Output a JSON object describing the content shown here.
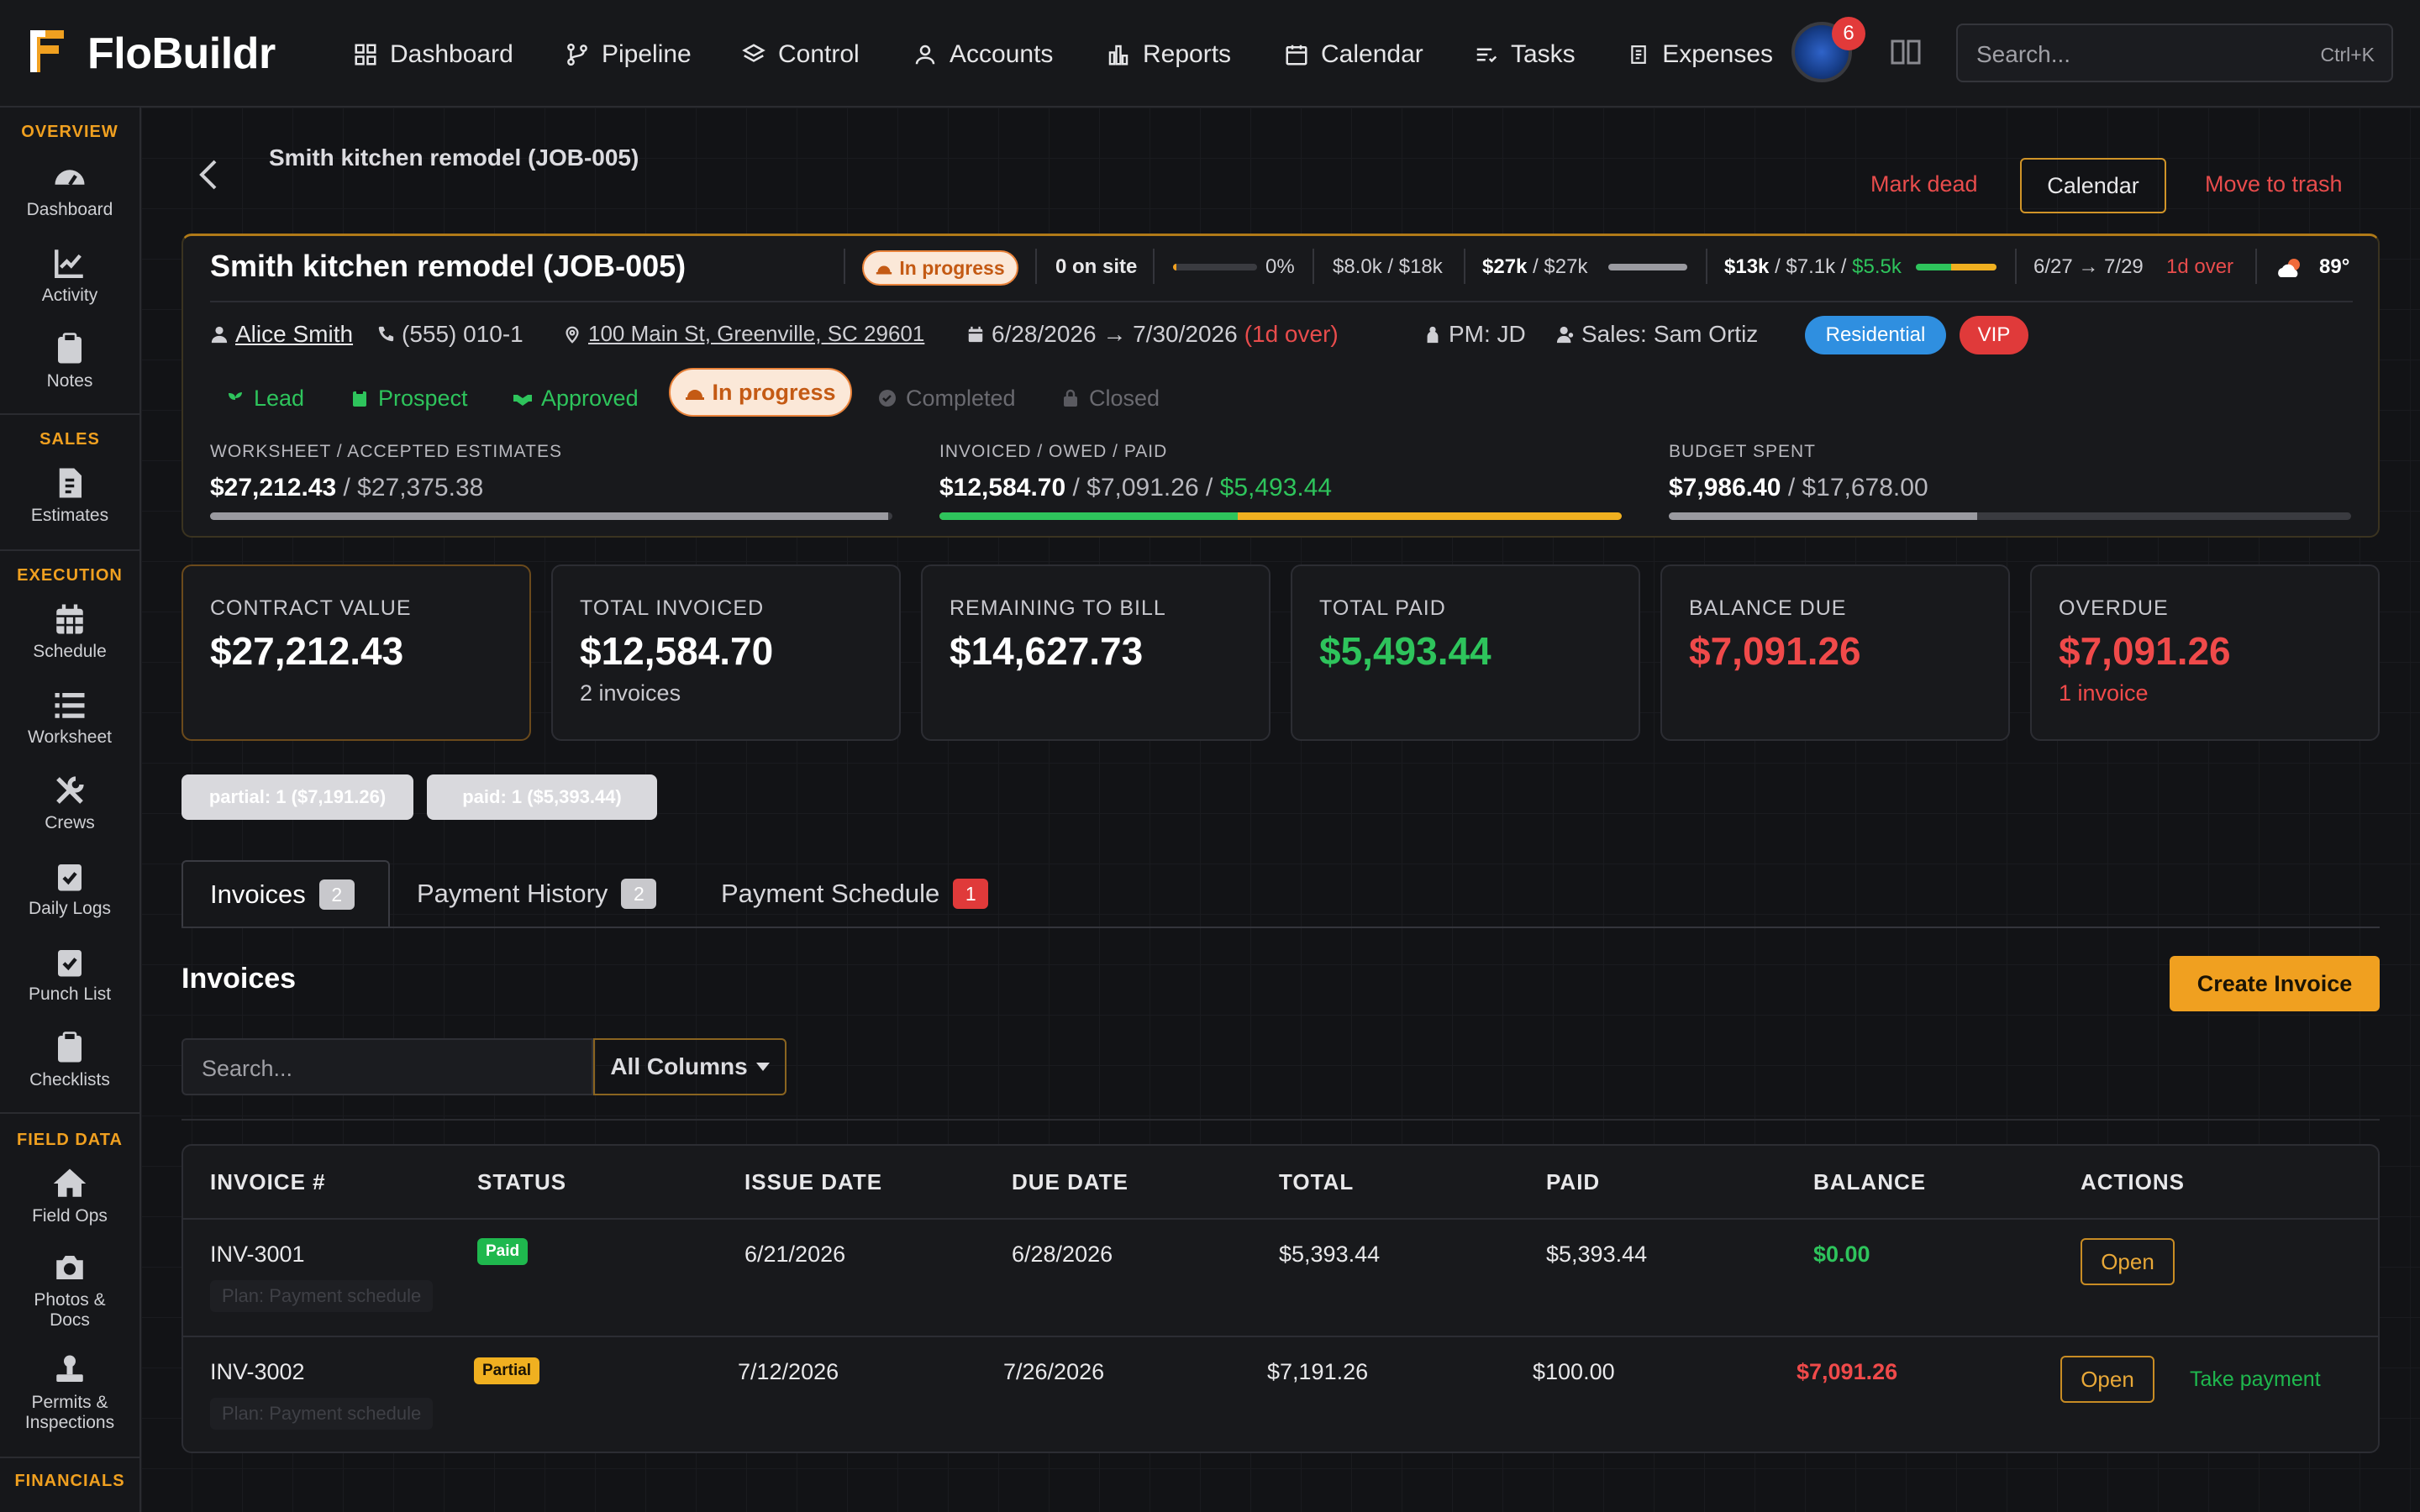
{
  "brand": {
    "name": "FloBuildr"
  },
  "nav": [
    {
      "label": "Dashboard",
      "icon": "dashboard-icon"
    },
    {
      "label": "Pipeline",
      "icon": "pipeline-icon"
    },
    {
      "label": "Control",
      "icon": "layers-icon"
    },
    {
      "label": "Accounts",
      "icon": "accounts-icon"
    },
    {
      "label": "Reports",
      "icon": "reports-icon"
    },
    {
      "label": "Calendar",
      "icon": "calendar-icon"
    },
    {
      "label": "Tasks",
      "icon": "tasks-icon"
    },
    {
      "label": "Expenses",
      "icon": "expenses-icon"
    }
  ],
  "notifications": {
    "count": "6"
  },
  "search": {
    "placeholder": "Search...",
    "shortcut": "Ctrl+K"
  },
  "sidebar": {
    "sections": [
      {
        "title": "OVERVIEW",
        "items": [
          {
            "label": "Dashboard",
            "icon": "gauge-icon"
          },
          {
            "label": "Activity",
            "icon": "activity-icon"
          },
          {
            "label": "Notes",
            "icon": "clipboard-icon"
          }
        ]
      },
      {
        "title": "SALES",
        "items": [
          {
            "label": "Estimates",
            "icon": "estimate-icon"
          }
        ]
      },
      {
        "title": "EXECUTION",
        "items": [
          {
            "label": "Schedule",
            "icon": "calendar-grid-icon"
          },
          {
            "label": "Worksheet",
            "icon": "list-icon"
          },
          {
            "label": "Crews",
            "icon": "tools-icon"
          },
          {
            "label": "Daily Logs",
            "icon": "clipboard-check-icon"
          },
          {
            "label": "Punch List",
            "icon": "clipboard-check-icon"
          },
          {
            "label": "Checklists",
            "icon": "clipboard-icon"
          }
        ]
      },
      {
        "title": "FIELD DATA",
        "items": [
          {
            "label": "Field Ops",
            "icon": "home-icon"
          },
          {
            "label": "Photos & Docs",
            "icon": "camera-icon"
          },
          {
            "label": "Permits & Inspections",
            "icon": "stamp-icon"
          }
        ]
      },
      {
        "title": "FINANCIALS",
        "items": []
      }
    ]
  },
  "page": {
    "breadcrumb": "Smith kitchen remodel (JOB-005)",
    "actions": {
      "mark_dead": "Mark dead",
      "calendar": "Calendar",
      "trash": "Move to trash"
    }
  },
  "job": {
    "title": "Smith kitchen remodel (JOB-005)",
    "status": "In progress",
    "on_site": "0 on site",
    "progress_pct": "0%",
    "progress_value": 0.04,
    "budget_short": "$8.0k / $18k",
    "worksheet_short_a": "$27k",
    "worksheet_short_b": "/ $27k",
    "worksheet_fill": 1.0,
    "invoice_short_a": "$13k",
    "invoice_short_b": "/ $7.1k /",
    "invoice_short_c": "$5.5k",
    "invoice_fill": 1.0,
    "dates_short": "6/27 → 7/29",
    "overdue_short": "1d over",
    "weather_temp": "89°",
    "customer": "Alice Smith",
    "phone": "(555) 010-1",
    "address": "100 Main St, Greenville, SC 29601",
    "date_range": "6/28/2026 → 7/30/2026",
    "date_over": "(1d over)",
    "pm": "PM: JD",
    "sales_label": "Sales:",
    "sales_name": "Sam Ortiz",
    "tags": [
      {
        "label": "Residential",
        "color": "#2f8fe0"
      },
      {
        "label": "VIP",
        "color": "#e03a3a"
      }
    ],
    "stages": [
      {
        "label": "Lead",
        "state": "done"
      },
      {
        "label": "Prospect",
        "state": "done"
      },
      {
        "label": "Approved",
        "state": "done"
      },
      {
        "label": "In progress",
        "state": "current"
      },
      {
        "label": "Completed",
        "state": "todo"
      },
      {
        "label": "Closed",
        "state": "todo"
      }
    ],
    "metrics": {
      "worksheet": {
        "label": "WORKSHEET / ACCEPTED ESTIMATES",
        "value": "$27,212.43",
        "total": "/ $27,375.38",
        "fill": 0.994
      },
      "invoiced": {
        "label": "INVOICED / OWED / PAID",
        "invoiced": "$12,584.70",
        "owed": "/ $7,091.26 /",
        "paid": "$5,493.44",
        "paid_fill": 0.437
      },
      "budget": {
        "label": "BUDGET SPENT",
        "spent": "$7,986.40",
        "total": "/ $17,678.00",
        "fill": 0.452
      }
    }
  },
  "summary": [
    {
      "label": "CONTRACT VALUE",
      "value": "$27,212.43",
      "sub": "",
      "color": "#ffffff"
    },
    {
      "label": "TOTAL INVOICED",
      "value": "$12,584.70",
      "sub": "2 invoices",
      "color": "#ffffff"
    },
    {
      "label": "REMAINING TO BILL",
      "value": "$14,627.73",
      "sub": "",
      "color": "#ffffff"
    },
    {
      "label": "TOTAL PAID",
      "value": "$5,493.44",
      "sub": "",
      "color": "#2ec45c"
    },
    {
      "label": "BALANCE DUE",
      "value": "$7,091.26",
      "sub": "",
      "color": "#f04a4a"
    },
    {
      "label": "OVERDUE",
      "value": "$7,091.26",
      "sub": "1 invoice",
      "color": "#f04a4a"
    }
  ],
  "chips": [
    "partial: 1 ($7,191.26)",
    "paid: 1 ($5,393.44)"
  ],
  "tabs": [
    {
      "label": "Invoices",
      "count": "2"
    },
    {
      "label": "Payment History",
      "count": "2"
    },
    {
      "label": "Payment Schedule",
      "count": "1"
    }
  ],
  "invoices": {
    "title": "Invoices",
    "create_label": "Create Invoice",
    "search_placeholder": "Search...",
    "columns_filter": "All Columns",
    "headers": [
      "INVOICE #",
      "STATUS",
      "ISSUE DATE",
      "DUE DATE",
      "TOTAL",
      "PAID",
      "BALANCE",
      "ACTIONS"
    ],
    "rows": [
      {
        "number": "INV-3001",
        "status": "Paid",
        "plan": "Plan: Payment schedule",
        "issue": "6/21/2026",
        "due": "6/28/2026",
        "total": "$5,393.44",
        "paid": "$5,393.44",
        "balance": "$0.00",
        "open": "Open",
        "take_payment": ""
      },
      {
        "number": "INV-3002",
        "status": "Partial",
        "plan": "Plan: Payment schedule",
        "issue": "7/12/2026",
        "due": "7/26/2026",
        "total": "$7,191.26",
        "paid": "$100.00",
        "balance": "$7,091.26",
        "open": "Open",
        "take_payment": "Take payment"
      }
    ]
  }
}
